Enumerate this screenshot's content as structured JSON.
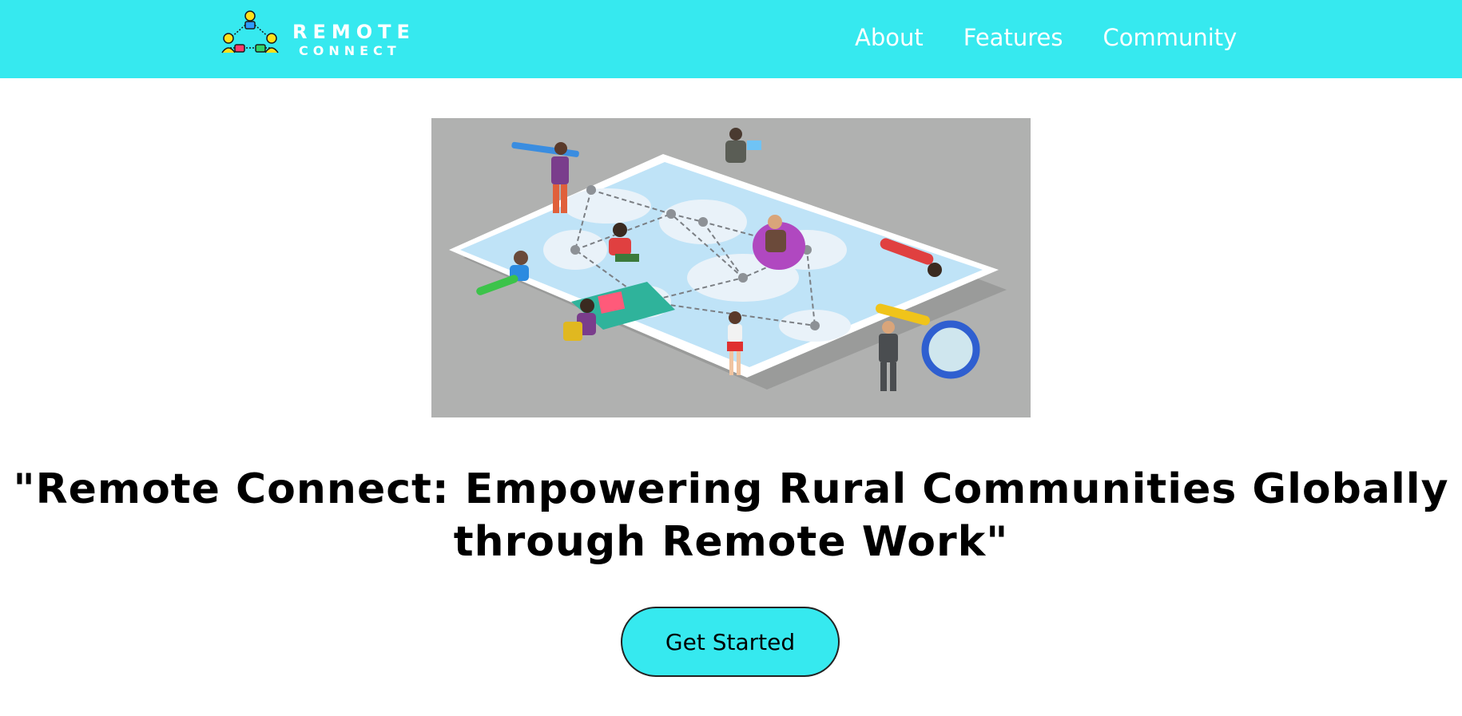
{
  "brand": {
    "name_line_1": "REMOTE",
    "name_line_2": "CONNECT",
    "accent_color": "#36e9ef"
  },
  "nav": {
    "links": [
      {
        "label": "About"
      },
      {
        "label": "Features"
      },
      {
        "label": "Community"
      }
    ]
  },
  "hero": {
    "image_icon": "world-map-remote-workers-illustration",
    "headline": "\"Remote Connect: Empowering Rural Communities Globally through Remote Work\"",
    "cta_label": "Get Started"
  }
}
